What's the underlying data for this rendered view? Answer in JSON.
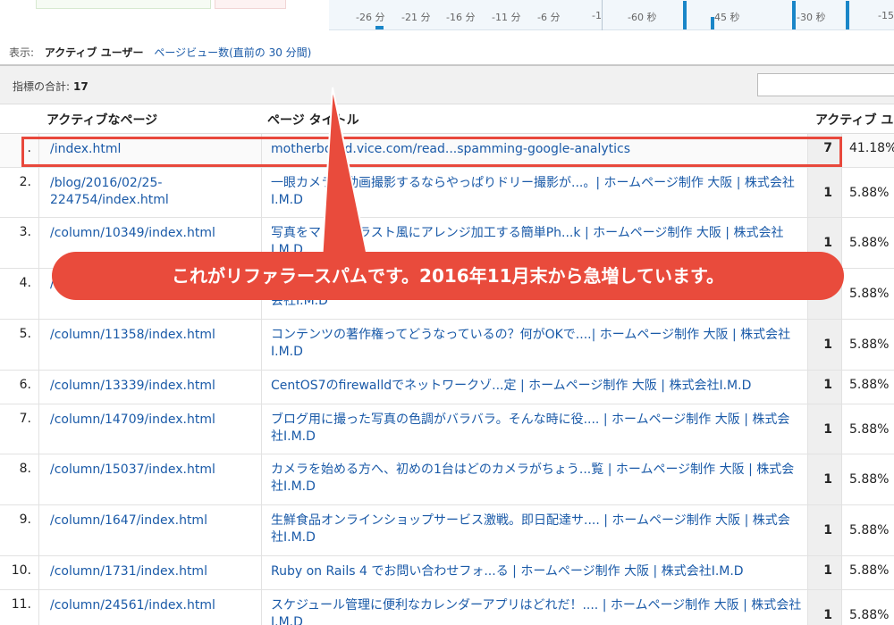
{
  "timeline": {
    "ticks": [
      "-26 分",
      "-21 分",
      "-16 分",
      "-11 分",
      "-6 分",
      "-1",
      "-60 秒",
      "-45 秒",
      "-30 秒",
      "-15"
    ]
  },
  "view": {
    "label": "表示:",
    "active": "アクティブ ユーザー",
    "alt": "ページビュー数(直前の 30 分間)"
  },
  "metrics": {
    "label": "指標の合計:",
    "total": "17"
  },
  "table": {
    "headers": {
      "page": "アクティブなページ",
      "title": "ページ タイトル",
      "users": "アクティブ ユ"
    },
    "rows": [
      {
        "num": ".",
        "page": "/index.html",
        "title": "motherboard.vice.com/read...spamming-google-analytics",
        "value": "7",
        "pct": "41.18%"
      },
      {
        "num": "2.",
        "page": "/blog/2016/02/25-224754/index.html",
        "title": "一眼カメラで動画撮影するならやっぱりドリー撮影が...。| ホームページ制作 大阪 | 株式会社I.M.D",
        "value": "1",
        "pct": "5.88%"
      },
      {
        "num": "3.",
        "page": "/column/10349/index.html",
        "title": "写真をマンガイラスト風にアレンジ加工する簡単Ph...k | ホームページ制作 大阪 | 株式会社I.M.D",
        "value": "1",
        "pct": "5.88%"
      },
      {
        "num": "4.",
        "page": "/",
        "title": "会社I.M.D",
        "value": "1",
        "pct": "5.88%"
      },
      {
        "num": "5.",
        "page": "/column/11358/index.html",
        "title": "コンテンツの著作権ってどうなっているの？何がOKで....| ホームページ制作 大阪 | 株式会社I.M.D",
        "value": "1",
        "pct": "5.88%"
      },
      {
        "num": "6.",
        "page": "/column/13339/index.html",
        "title": "CentOS7のfirewalldでネットワークゾ...定 | ホームページ制作 大阪 | 株式会社I.M.D",
        "value": "1",
        "pct": "5.88%"
      },
      {
        "num": "7.",
        "page": "/column/14709/index.html",
        "title": "ブログ用に撮った写真の色調がバラバラ。そんな時に役.... | ホームページ制作 大阪 | 株式会社I.M.D",
        "value": "1",
        "pct": "5.88%"
      },
      {
        "num": "8.",
        "page": "/column/15037/index.html",
        "title": "カメラを始める方へ、初めの1台はどのカメラがちょう...覧 | ホームページ制作 大阪 | 株式会社I.M.D",
        "value": "1",
        "pct": "5.88%"
      },
      {
        "num": "9.",
        "page": "/column/1647/index.html",
        "title": "生鮮食品オンラインショップサービス激戦。即日配達サ.... | ホームページ制作 大阪 | 株式会社I.M.D",
        "value": "1",
        "pct": "5.88%"
      },
      {
        "num": "10.",
        "page": "/column/1731/index.html",
        "title": "Ruby on Rails 4 でお問い合わせフォ...る | ホームページ制作 大阪 | 株式会社I.M.D",
        "value": "1",
        "pct": "5.88%"
      },
      {
        "num": "11.",
        "page": "/column/24561/index.html",
        "title": "スケジュール管理に便利なカレンダーアプリはどれだ！.... | ホームページ制作 大阪 | 株式会社I.M.D",
        "value": "1",
        "pct": "5.88%"
      }
    ]
  },
  "callout": {
    "text": "これがリファラースパムです。2016年11月末から急増しています。"
  },
  "colors": {
    "accent_red": "#e94b3c",
    "link_blue": "#1a5aa8",
    "timeline_bar": "#1a86c8"
  }
}
